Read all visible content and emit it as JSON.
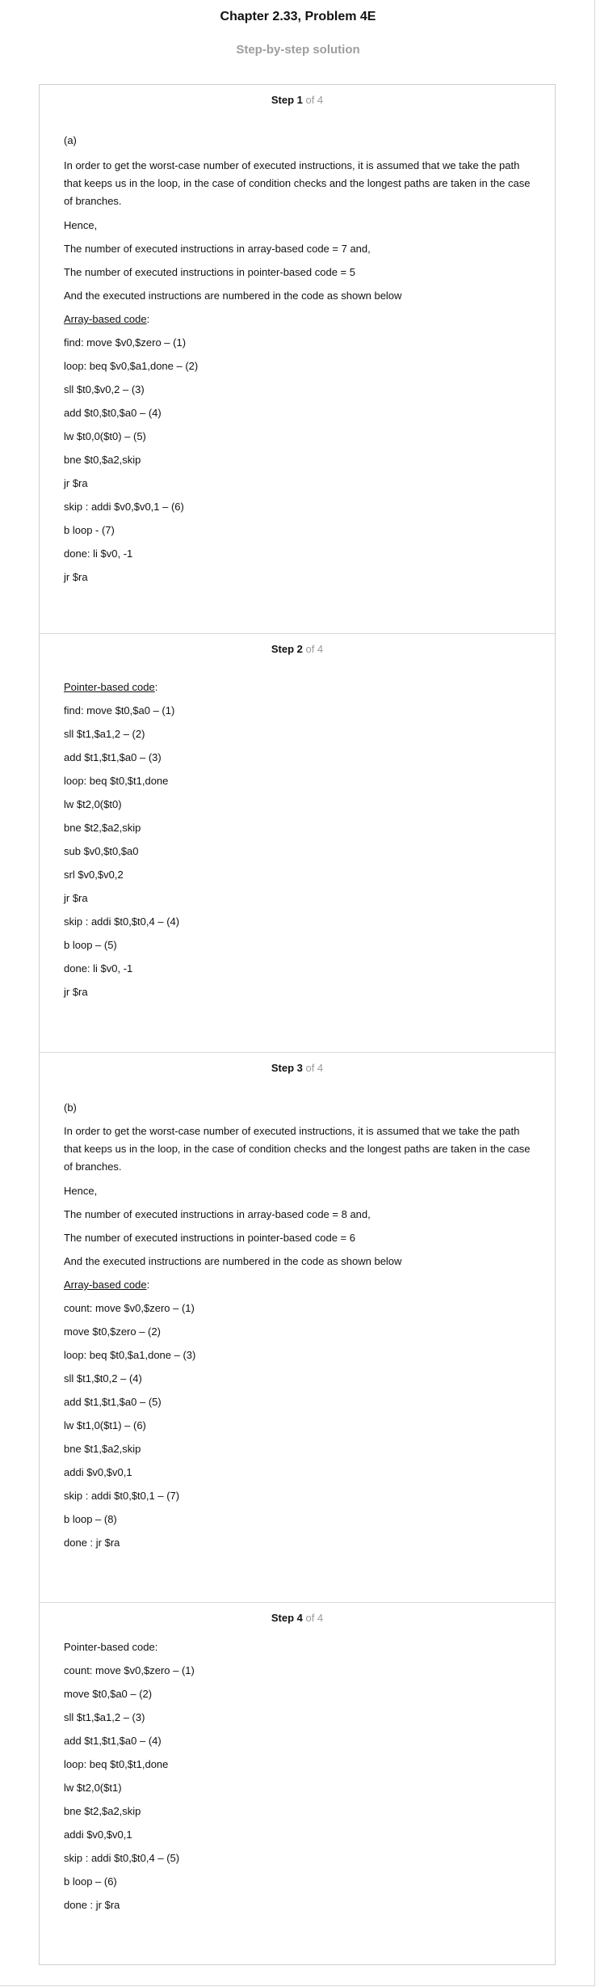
{
  "title": "Chapter 2.33, Problem 4E",
  "subtitle": "Step-by-step solution",
  "steps": [
    {
      "num": "Step 1",
      "of": " of 4",
      "part": "(a)",
      "intro": "In order to get the worst-case number of executed instructions, it is assumed that we take the path that keeps us in the loop, in the case of condition checks and the longest paths are taken in the case of branches.",
      "hence": "Hence,",
      "count_array": "The number of executed instructions in array-based code = 7 and,",
      "count_pointer": "The number of executed instructions in pointer-based code = 5",
      "shown": "And the executed instructions are numbered in the code as shown below",
      "code_heading": "Array-based code",
      "code_heading_suffix": ":",
      "code": [
        "find: move $v0,$zero – (1)",
        "loop: beq $v0,$a1,done – (2)",
        "sll $t0,$v0,2 – (3)",
        "add $t0,$t0,$a0 – (4)",
        "lw $t0,0($t0) – (5)",
        "bne $t0,$a2,skip",
        "jr $ra",
        "skip : addi $v0,$v0,1 – (6)",
        "b loop - (7)",
        "done: li $v0, -1",
        "jr $ra"
      ]
    },
    {
      "num": "Step 2",
      "of": " of 4",
      "code_heading": "Pointer-based code",
      "code_heading_suffix": ":",
      "code": [
        "find: move $t0,$a0 – (1)",
        "sll $t1,$a1,2 – (2)",
        "add $t1,$t1,$a0 – (3)",
        "loop: beq $t0,$t1,done",
        "lw $t2,0($t0)",
        "bne $t2,$a2,skip",
        "sub $v0,$t0,$a0",
        "srl $v0,$v0,2",
        "jr $ra",
        "skip : addi $t0,$t0,4 – (4)",
        "b loop – (5)",
        "done: li $v0, -1",
        "jr $ra"
      ]
    },
    {
      "num": "Step 3",
      "of": " of 4",
      "part": "(b)",
      "intro": "In order to get the worst-case number of executed instructions, it is assumed that we take the path that keeps us in the loop, in the case of condition checks and the longest paths are taken in the case of branches.",
      "hence": "Hence,",
      "count_array": "The number of executed instructions in array-based code = 8 and,",
      "count_pointer": "The number of executed instructions in pointer-based code = 6",
      "shown": "And the executed instructions are numbered in the code as shown below",
      "code_heading": "Array-based code",
      "code_heading_suffix": ":",
      "code": [
        "count: move $v0,$zero – (1)",
        "move $t0,$zero – (2)",
        "loop: beq $t0,$a1,done – (3)",
        "sll $t1,$t0,2 – (4)",
        "add $t1,$t1,$a0 – (5)",
        "lw $t1,0($t1) – (6)",
        "bne $t1,$a2,skip",
        "addi $v0,$v0,1",
        "skip : addi $t0,$t0,1 – (7)",
        "b loop – (8)",
        "done : jr $ra"
      ]
    },
    {
      "num": "Step 4",
      "of": " of 4",
      "code_heading": "Pointer-based code:",
      "code": [
        "count: move $v0,$zero – (1)",
        "move $t0,$a0 – (2)",
        "sll $t1,$a1,2 – (3)",
        "add $t1,$t1,$a0 – (4)",
        "loop: beq $t0,$t1,done",
        "lw $t2,0($t1)",
        "bne $t2,$a2,skip",
        "addi $v0,$v0,1",
        "skip : addi $t0,$t0,4 – (5)",
        "b loop – (6)",
        "done : jr $ra"
      ]
    }
  ]
}
